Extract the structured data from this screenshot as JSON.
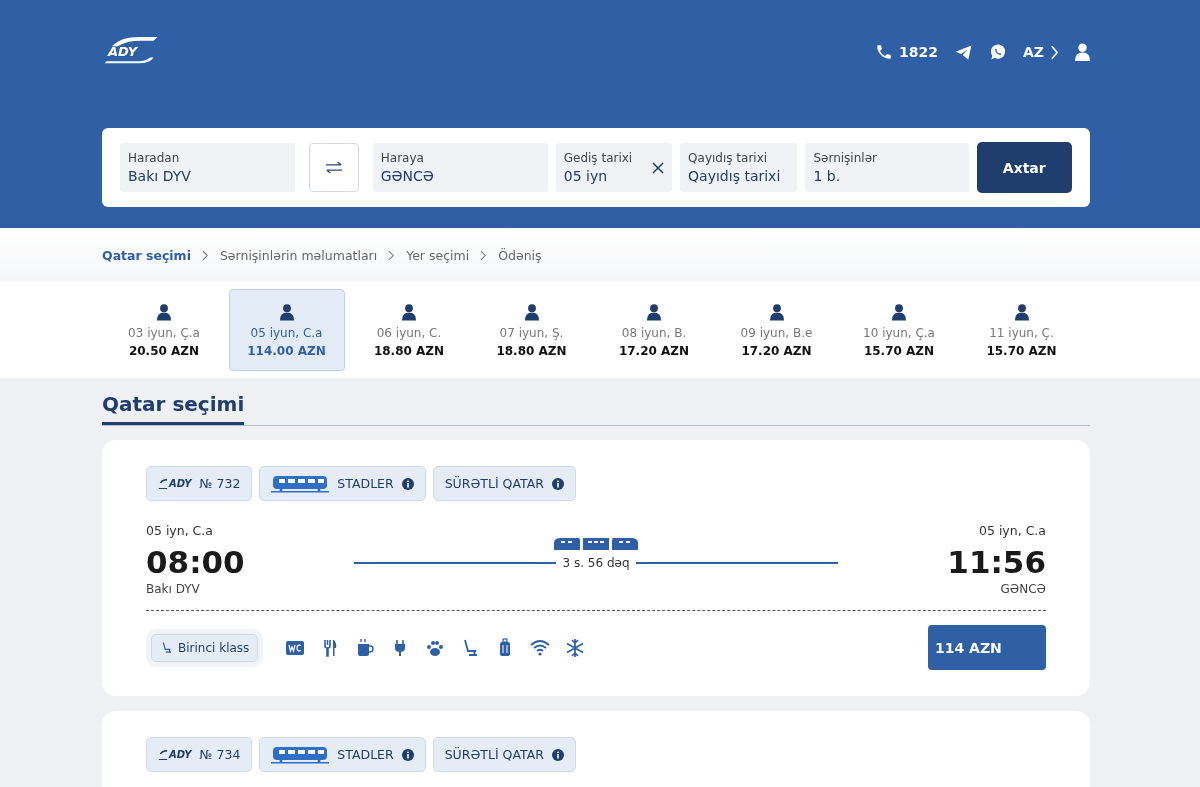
{
  "header": {
    "logo": "ADY",
    "phone": "1822",
    "language": "AZ"
  },
  "search": {
    "fields": [
      {
        "label": "Haradan",
        "value": "Bakı DYV"
      },
      {
        "label": "Haraya",
        "value": "GƏNCƏ"
      },
      {
        "label": "Gediş tarixi",
        "value": "05 iyn",
        "clearable": true
      },
      {
        "label": "Qayıdış tarixi",
        "value": "Qayıdış tarixi"
      },
      {
        "label": "Sərnişinlər",
        "value": "1 b."
      }
    ],
    "button": "Axtar"
  },
  "breadcrumbs": [
    {
      "label": "Qatar seçimi",
      "selected": true
    },
    {
      "label": "Sərnişinlərin məlumatları",
      "selected": false
    },
    {
      "label": "Yer seçimi",
      "selected": false
    },
    {
      "label": "Ödəniş",
      "selected": false
    }
  ],
  "dates": [
    {
      "date": "03 iyun, Ç.a",
      "price": "20.50 AZN",
      "selected": false
    },
    {
      "date": "05 iyun, C.a",
      "price": "114.00 AZN",
      "selected": true
    },
    {
      "date": "06 iyun, C.",
      "price": "18.80 AZN",
      "selected": false
    },
    {
      "date": "07 iyun, Ş.",
      "price": "18.80 AZN",
      "selected": false
    },
    {
      "date": "08 iyun, B.",
      "price": "17.20 AZN",
      "selected": false
    },
    {
      "date": "09 iyun, B.e",
      "price": "17.20 AZN",
      "selected": false
    },
    {
      "date": "10 iyun, Ç.a",
      "price": "15.70 AZN",
      "selected": false
    },
    {
      "date": "11 iyun, Ç.",
      "price": "15.70 AZN",
      "selected": false
    }
  ],
  "section_title": "Qatar seçimi",
  "trains": [
    {
      "operator": "ADY",
      "number": "№ 732",
      "model": "STADLER",
      "type": "SÜRƏTLİ QATAR",
      "depart_date": "05 iyn, C.a",
      "depart_time": "08:00",
      "depart_station": "Bakı DYV",
      "duration": "3 s. 56 dəq",
      "arrive_date": "05 iyn, C.a",
      "arrive_time": "11:56",
      "arrive_station": "GƏNCƏ",
      "class": "Birinci klass",
      "price": "114 AZN"
    },
    {
      "operator": "ADY",
      "number": "№ 734",
      "model": "STADLER",
      "type": "SÜRƏTLİ QATAR"
    }
  ]
}
